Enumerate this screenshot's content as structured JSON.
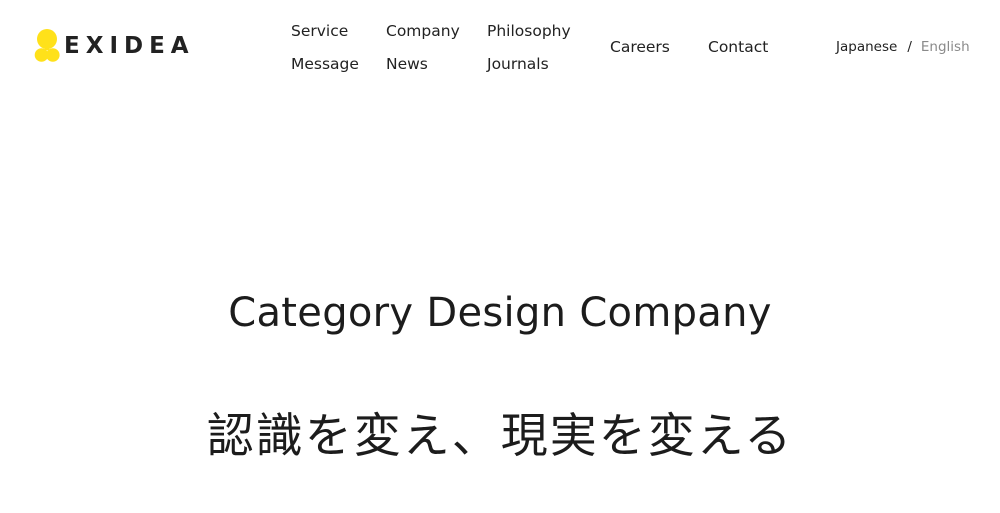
{
  "brand": {
    "name": "EXIDEA",
    "accent_color": "#FFE11A",
    "logo_icon": "yellow-circles-logo-icon"
  },
  "nav": {
    "service": "Service",
    "company": "Company",
    "philosophy": "Philosophy",
    "message": "Message",
    "news": "News",
    "journals": "Journals",
    "careers": "Careers",
    "contact": "Contact"
  },
  "language": {
    "japanese": "Japanese",
    "separator": "/",
    "english": "English",
    "active": "Japanese"
  },
  "hero": {
    "tagline_en": "Category Design Company",
    "tagline_ja": "認識を変え、現実を変える"
  }
}
